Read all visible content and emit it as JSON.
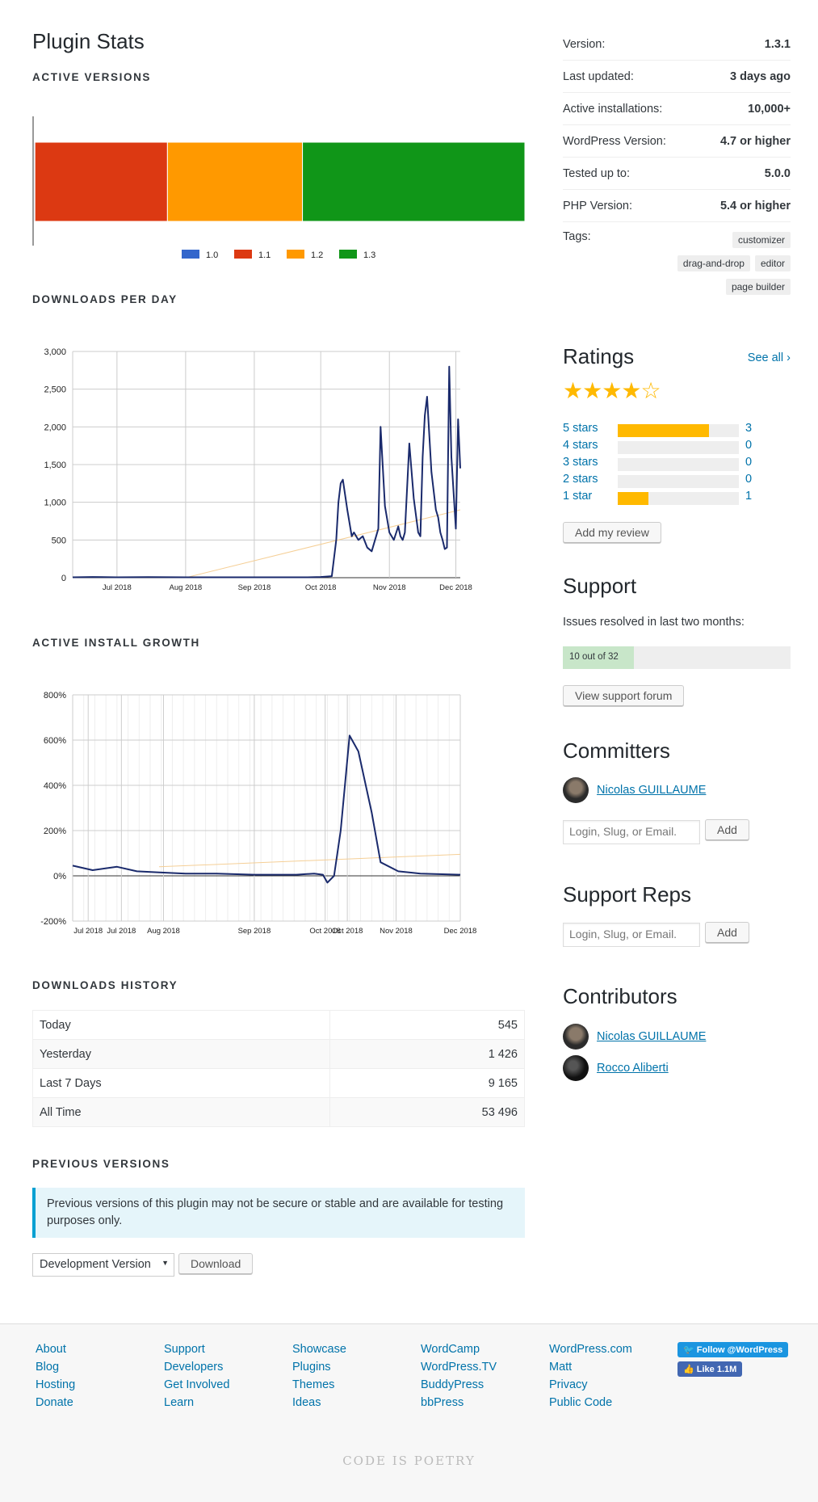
{
  "page_title": "Plugin Stats",
  "active_versions": {
    "heading": "ACTIVE VERSIONS",
    "legend": [
      {
        "label": "1.0",
        "color": "#3366cc"
      },
      {
        "label": "1.1",
        "color": "#dc3912"
      },
      {
        "label": "1.2",
        "color": "#ff9900"
      },
      {
        "label": "1.3",
        "color": "#109618"
      }
    ]
  },
  "downloads_per_day": {
    "heading": "DOWNLOADS PER DAY",
    "y_ticks": [
      "3,000",
      "2,500",
      "2,000",
      "1,500",
      "1,000",
      "500",
      "0"
    ],
    "x_ticks": [
      "Jul 2018",
      "Aug 2018",
      "Sep 2018",
      "Oct 2018",
      "Nov 2018",
      "Dec 2018"
    ]
  },
  "active_install_growth": {
    "heading": "ACTIVE INSTALL GROWTH",
    "y_ticks": [
      "800%",
      "600%",
      "400%",
      "200%",
      "0%",
      "-200%"
    ],
    "x_ticks": [
      "Jul 2018",
      "Jul 2018",
      "Aug 2018",
      "Sep 2018",
      "Oct 2018",
      "Oct 2018",
      "Nov 2018",
      "Dec 2018"
    ]
  },
  "chart_data": [
    {
      "type": "bar",
      "title": "ACTIVE VERSIONS",
      "categories": [
        "1.0",
        "1.1",
        "1.2",
        "1.3"
      ],
      "values": [
        0.2,
        27,
        27.5,
        45.3
      ],
      "stacked": true,
      "unit": "percent",
      "colors": [
        "#3366cc",
        "#dc3912",
        "#ff9900",
        "#109618"
      ]
    },
    {
      "type": "line",
      "title": "DOWNLOADS PER DAY",
      "ylim": [
        0,
        3000
      ],
      "x": [
        "2018-06-11",
        "2018-06-20",
        "2018-07-01",
        "2018-07-15",
        "2018-08-01",
        "2018-08-15",
        "2018-09-01",
        "2018-09-15",
        "2018-09-25",
        "2018-10-01",
        "2018-10-06",
        "2018-10-08",
        "2018-10-09",
        "2018-10-10",
        "2018-10-11",
        "2018-10-13",
        "2018-10-15",
        "2018-10-16",
        "2018-10-18",
        "2018-10-20",
        "2018-10-22",
        "2018-10-24",
        "2018-10-26",
        "2018-10-27",
        "2018-10-28",
        "2018-10-30",
        "2018-11-01",
        "2018-11-03",
        "2018-11-05",
        "2018-11-06",
        "2018-11-07",
        "2018-11-08",
        "2018-11-10",
        "2018-11-12",
        "2018-11-14",
        "2018-11-15",
        "2018-11-16",
        "2018-11-17",
        "2018-11-18",
        "2018-11-20",
        "2018-11-22",
        "2018-11-23",
        "2018-11-24",
        "2018-11-25",
        "2018-11-26",
        "2018-11-27",
        "2018-11-28",
        "2018-11-29",
        "2018-12-01",
        "2018-12-02",
        "2018-12-03"
      ],
      "series": [
        {
          "values": [
            5,
            10,
            5,
            8,
            5,
            5,
            5,
            5,
            5,
            10,
            20,
            500,
            1000,
            1250,
            1300,
            900,
            550,
            600,
            500,
            550,
            400,
            350,
            550,
            650,
            2000,
            950,
            600,
            500,
            680,
            550,
            500,
            600,
            1780,
            1050,
            600,
            550,
            1600,
            2150,
            2400,
            1400,
            900,
            800,
            600,
            500,
            380,
            400,
            2800,
            1600,
            650,
            2100,
            1450
          ]
        }
      ]
    },
    {
      "type": "line",
      "title": "ACTIVE INSTALL GROWTH",
      "ylim": [
        -200,
        800
      ],
      "x": [
        "2018-06-11",
        "2018-06-20",
        "2018-07-01",
        "2018-07-10",
        "2018-07-20",
        "2018-08-01",
        "2018-08-15",
        "2018-09-01",
        "2018-09-10",
        "2018-09-20",
        "2018-09-28",
        "2018-10-02",
        "2018-10-04",
        "2018-10-07",
        "2018-10-10",
        "2018-10-14",
        "2018-10-18",
        "2018-10-24",
        "2018-10-28",
        "2018-11-05",
        "2018-11-15",
        "2018-12-03"
      ],
      "series": [
        {
          "values": [
            45,
            25,
            40,
            20,
            15,
            10,
            10,
            5,
            5,
            5,
            10,
            5,
            -30,
            0,
            200,
            620,
            550,
            280,
            60,
            20,
            10,
            5
          ]
        }
      ]
    }
  ],
  "downloads_history": {
    "heading": "DOWNLOADS HISTORY",
    "rows": [
      {
        "label": "Today",
        "value": "545"
      },
      {
        "label": "Yesterday",
        "value": "1 426"
      },
      {
        "label": "Last 7 Days",
        "value": "9 165"
      },
      {
        "label": "All Time",
        "value": "53 496"
      }
    ]
  },
  "previous_versions": {
    "heading": "PREVIOUS VERSIONS",
    "notice": "Previous versions of this plugin may not be secure or stable and are available for testing purposes only.",
    "select_value": "Development Version",
    "download_label": "Download"
  },
  "meta": {
    "rows": [
      {
        "label": "Version:",
        "value": "1.3.1"
      },
      {
        "label": "Last updated:",
        "value": "3 days ago"
      },
      {
        "label": "Active installations:",
        "value": "10,000+"
      },
      {
        "label": "WordPress Version:",
        "value": "4.7 or higher"
      },
      {
        "label": "Tested up to:",
        "value": "5.0.0"
      },
      {
        "label": "PHP Version:",
        "value": "5.4 or higher"
      }
    ],
    "tags_label": "Tags:",
    "tags": [
      "customizer",
      "drag-and-drop",
      "editor",
      "page builder"
    ]
  },
  "ratings": {
    "heading": "Ratings",
    "see_all": "See all",
    "stars_value": 4,
    "stars_max": 5,
    "rows": [
      {
        "label": "5 stars",
        "count": "3",
        "fraction": 0.75
      },
      {
        "label": "4 stars",
        "count": "0",
        "fraction": 0
      },
      {
        "label": "3 stars",
        "count": "0",
        "fraction": 0
      },
      {
        "label": "2 stars",
        "count": "0",
        "fraction": 0
      },
      {
        "label": "1 star",
        "count": "1",
        "fraction": 0.25
      }
    ],
    "add_review": "Add my review",
    "accent": "#ffb900"
  },
  "support": {
    "heading": "Support",
    "issues_label": "Issues resolved in last two months:",
    "resolved_text": "10 out of 32",
    "resolved": 10,
    "total": 32,
    "view_forum": "View support forum"
  },
  "committers": {
    "heading": "Committers",
    "people": [
      "Nicolas GUILLAUME"
    ],
    "input_placeholder": "Login, Slug, or Email.",
    "add_label": "Add"
  },
  "support_reps": {
    "heading": "Support Reps",
    "input_placeholder": "Login, Slug, or Email.",
    "add_label": "Add"
  },
  "contributors": {
    "heading": "Contributors",
    "people": [
      "Nicolas GUILLAUME",
      "Rocco Aliberti"
    ]
  },
  "footer": {
    "columns": [
      [
        "About",
        "Blog",
        "Hosting",
        "Donate"
      ],
      [
        "Support",
        "Developers",
        "Get Involved",
        "Learn"
      ],
      [
        "Showcase",
        "Plugins",
        "Themes",
        "Ideas"
      ],
      [
        "WordCamp",
        "WordPress.TV",
        "BuddyPress",
        "bbPress"
      ],
      [
        "WordPress.com",
        "Matt",
        "Privacy",
        "Public Code"
      ]
    ],
    "twitter": "Follow @WordPress",
    "facebook": "Like 1.1M",
    "tagline": "CODE IS POETRY"
  }
}
